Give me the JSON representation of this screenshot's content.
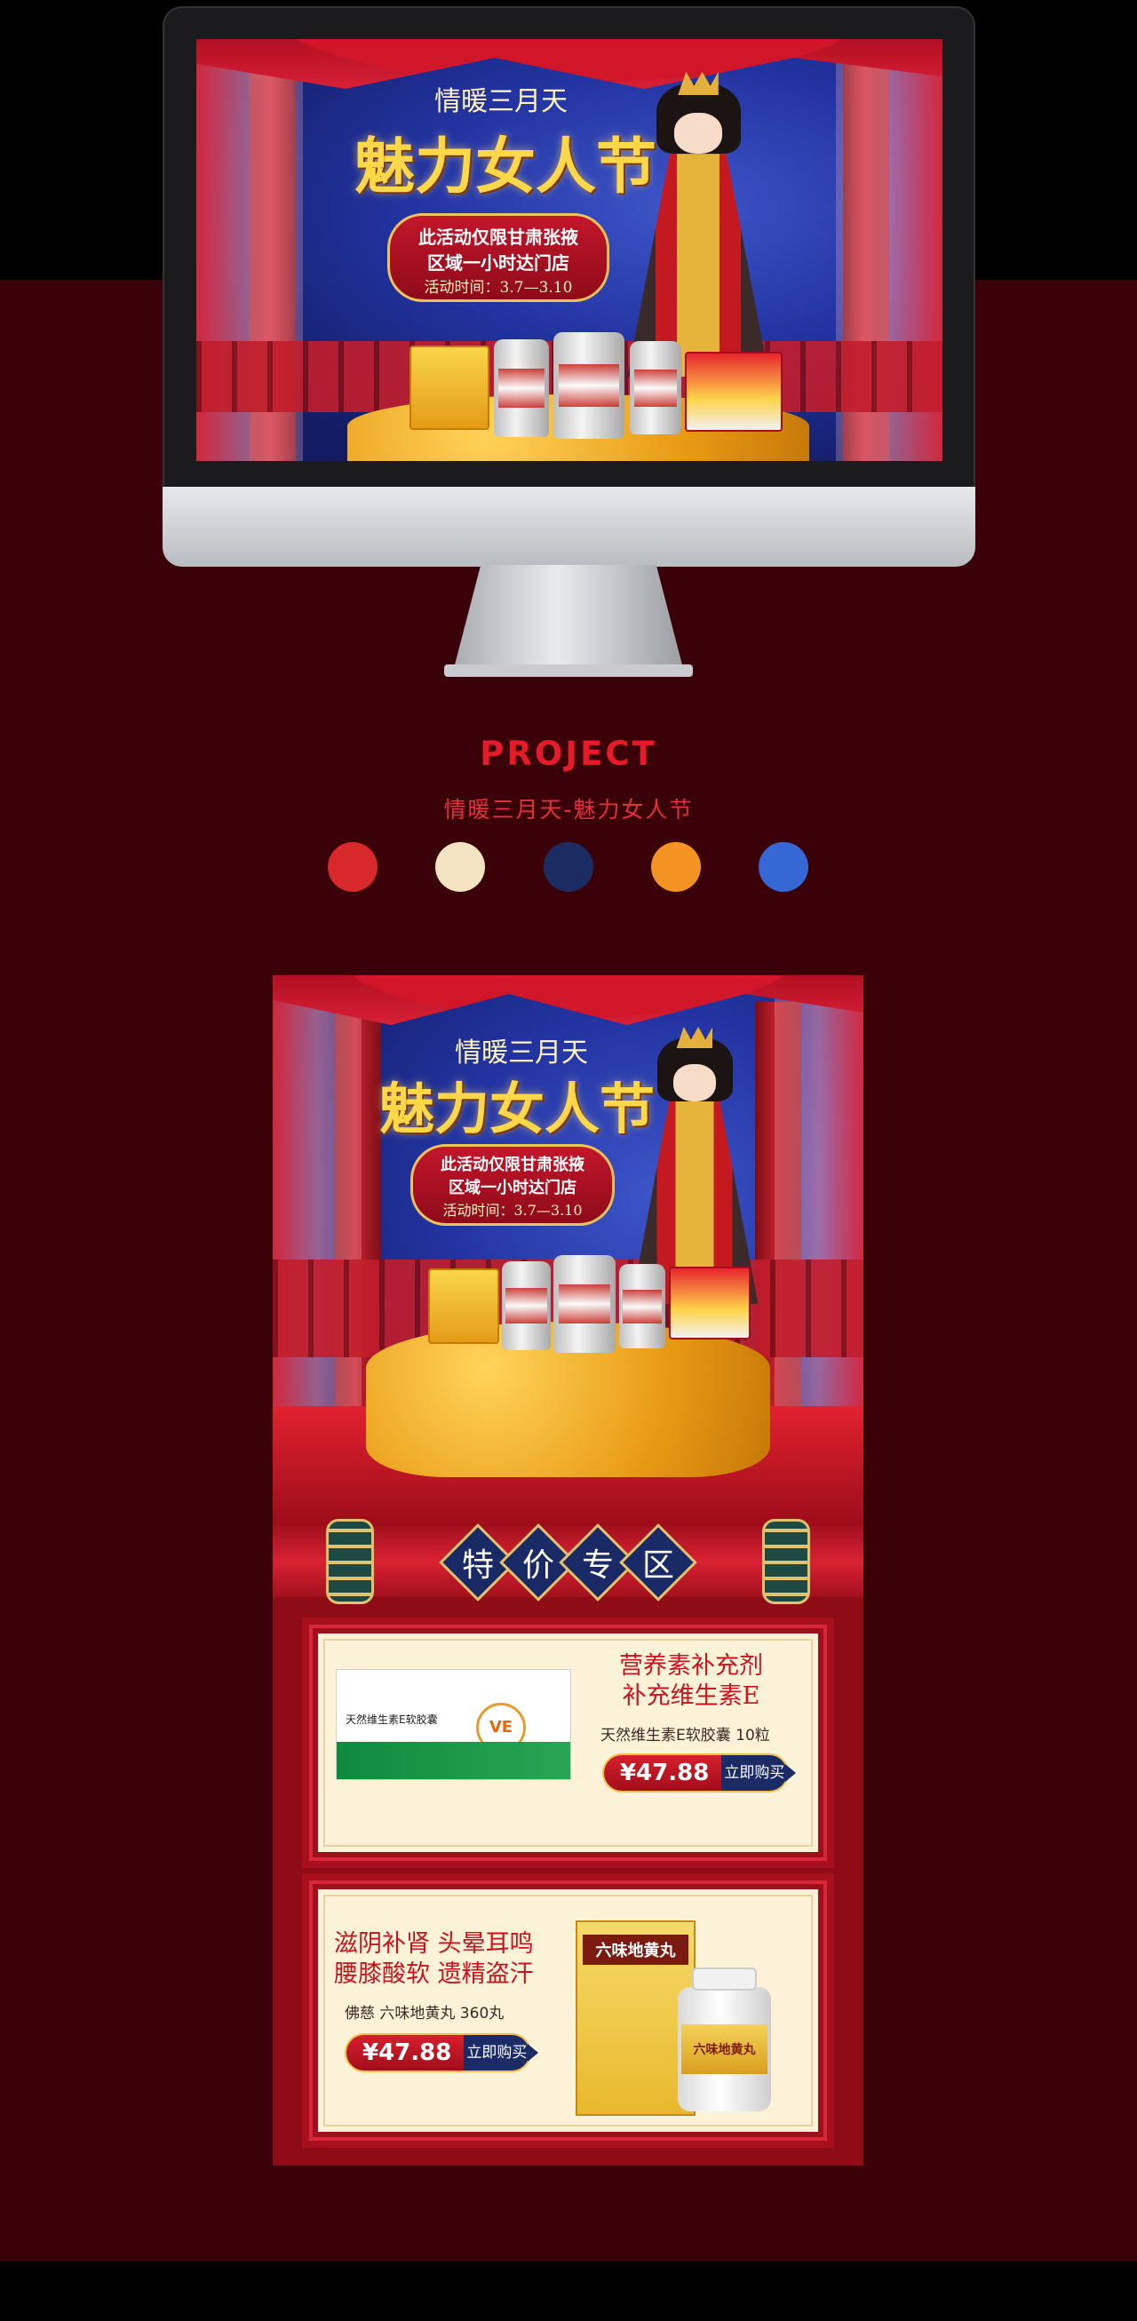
{
  "banner": {
    "subtitle": "情暖三月天",
    "title": "魅力女人节",
    "notice_line1": "此活动仅限甘肃张掖",
    "notice_line2": "区域一小时达门店",
    "notice_time": "活动时间：3.7—3.10"
  },
  "project": {
    "heading": "PROJECT",
    "subheading": "情暖三月天-魅力女人节",
    "palette": [
      "#d7282c",
      "#f4e3c1",
      "#1b2c63",
      "#f39422",
      "#3568d4"
    ]
  },
  "zone": {
    "chars": [
      "特",
      "价",
      "专",
      "区"
    ]
  },
  "products": [
    {
      "headline_1": "营养素补充剂",
      "headline_2": "补充维生素E",
      "name": "天然维生素E软胶囊 10粒",
      "price": "¥47.88",
      "buy_label": "立即购买",
      "pack_text": "天然维生素E软胶囊",
      "pack_badge": "VE"
    },
    {
      "headline_1": "滋阴补肾 头晕耳鸣",
      "headline_2": "腰膝酸软 遗精盗汗",
      "name": "佛慈 六味地黄丸 360丸",
      "price": "¥47.88",
      "buy_label": "立即购买",
      "pack_text": "六味地黄丸"
    }
  ]
}
